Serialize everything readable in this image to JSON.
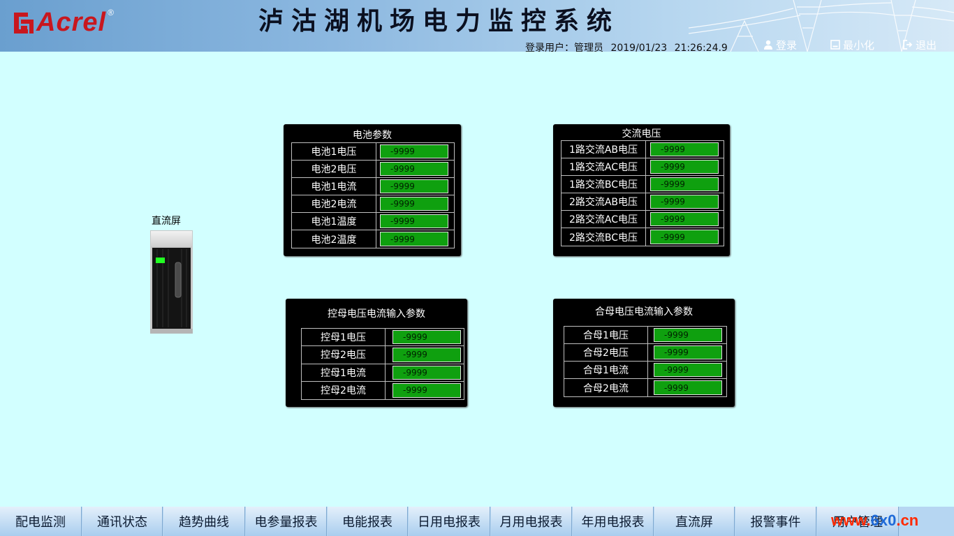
{
  "header": {
    "logo_text": "Acrel",
    "logo_reg": "®",
    "title": "泸沽湖机场电力监控系统",
    "login_user_label": "登录用户：",
    "login_user": "管理员",
    "date": "2019/01/23",
    "time": "21:26:24.9",
    "buttons": {
      "login": "登录",
      "minimize": "最小化",
      "exit": "退出"
    }
  },
  "device": {
    "label": "直流屏"
  },
  "panels": {
    "battery": {
      "title": "电池参数",
      "rows": [
        {
          "label": "电池1电压",
          "value": "-9999"
        },
        {
          "label": "电池2电压",
          "value": "-9999"
        },
        {
          "label": "电池1电流",
          "value": "-9999"
        },
        {
          "label": "电池2电流",
          "value": "-9999"
        },
        {
          "label": "电池1温度",
          "value": "-9999"
        },
        {
          "label": "电池2温度",
          "value": "-9999"
        }
      ]
    },
    "ac": {
      "title": "交流电压",
      "rows": [
        {
          "label": "1路交流AB电压",
          "value": "-9999"
        },
        {
          "label": "1路交流AC电压",
          "value": "-9999"
        },
        {
          "label": "1路交流BC电压",
          "value": "-9999"
        },
        {
          "label": "2路交流AB电压",
          "value": "-9999"
        },
        {
          "label": "2路交流AC电压",
          "value": "-9999"
        },
        {
          "label": "2路交流BC电压",
          "value": "-9999"
        }
      ]
    },
    "control_bus": {
      "title": "控母电压电流输入参数",
      "rows": [
        {
          "label": "控母1电压",
          "value": "-9999"
        },
        {
          "label": "控母2电压",
          "value": "-9999"
        },
        {
          "label": "控母1电流",
          "value": "-9999"
        },
        {
          "label": "控母2电流",
          "value": "-9999"
        }
      ]
    },
    "closing_bus": {
      "title": "合母电压电流输入参数",
      "rows": [
        {
          "label": "合母1电压",
          "value": "-9999"
        },
        {
          "label": "合母2电压",
          "value": "-9999"
        },
        {
          "label": "合母1电流",
          "value": "-9999"
        },
        {
          "label": "合母2电流",
          "value": "-9999"
        }
      ]
    }
  },
  "nav": {
    "items": [
      "配电监测",
      "通讯状态",
      "趋势曲线",
      "电参量报表",
      "电能报表",
      "日用电报表",
      "月用电报表",
      "年用电报表",
      "直流屏",
      "报警事件",
      "用户管理"
    ]
  },
  "watermark": {
    "left": "www.",
    "mid": "6x0",
    "right": ".cn"
  },
  "colors": {
    "background": "#d2ffff",
    "value_green": "#0fa00f",
    "logo_red": "#c8171e"
  }
}
